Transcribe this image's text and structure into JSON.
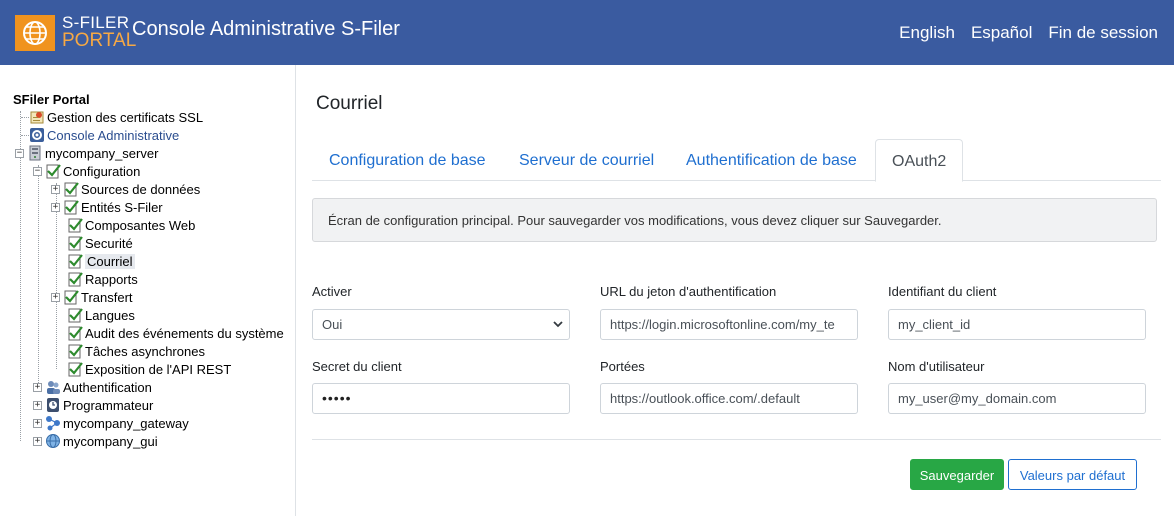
{
  "header": {
    "logo_line1": "S-FILER",
    "logo_line2": "PORTAL",
    "title": "Console Administrative S-Filer",
    "links": [
      "English",
      "Español",
      "Fin de session"
    ],
    "bg_color": "#3a5ba0",
    "logo_color": "#f0931e"
  },
  "tree": {
    "root": "SFiler Portal",
    "items": [
      {
        "label": "Gestion des certificats SSL",
        "icon": "certificate-icon"
      },
      {
        "label": "Console Administrative",
        "icon": "gear-icon"
      },
      {
        "label": "mycompany_server",
        "icon": "server-icon"
      },
      {
        "label": "Configuration",
        "icon": "check-doc-icon"
      },
      {
        "label": "Sources de données",
        "icon": "check-doc-icon"
      },
      {
        "label": "Entités S-Filer",
        "icon": "check-doc-icon"
      },
      {
        "label": "Composantes Web",
        "icon": "check-doc-icon"
      },
      {
        "label": "Securité",
        "icon": "check-doc-icon"
      },
      {
        "label": "Courriel",
        "icon": "check-doc-icon"
      },
      {
        "label": "Rapports",
        "icon": "check-doc-icon"
      },
      {
        "label": "Transfert",
        "icon": "check-doc-icon"
      },
      {
        "label": "Langues",
        "icon": "check-doc-icon"
      },
      {
        "label": "Audit des événements du système",
        "icon": "check-doc-icon"
      },
      {
        "label": "Tâches asynchrones",
        "icon": "check-doc-icon"
      },
      {
        "label": "Exposition de l'API REST",
        "icon": "check-doc-icon"
      },
      {
        "label": "Authentification",
        "icon": "users-icon"
      },
      {
        "label": "Programmateur",
        "icon": "clock-icon"
      },
      {
        "label": "mycompany_gateway",
        "icon": "network-icon"
      },
      {
        "label": "mycompany_gui",
        "icon": "globe-icon"
      }
    ]
  },
  "main": {
    "title": "Courriel",
    "tabs": [
      "Configuration de base",
      "Serveur de courriel",
      "Authentification de base",
      "OAuth2"
    ],
    "active_tab": "OAuth2",
    "info": "Écran de configuration principal. Pour sauvegarder vos modifications, vous devez cliquer sur Sauvegarder.",
    "fields": {
      "activer": {
        "label": "Activer",
        "value": "Oui"
      },
      "url_jeton": {
        "label": "URL du jeton d'authentification",
        "value": "https://login.microsoftonline.com/my_te"
      },
      "client_id": {
        "label": "Identifiant du client",
        "value": "my_client_id"
      },
      "secret": {
        "label": "Secret du client",
        "value": "•••••"
      },
      "portees": {
        "label": "Portées",
        "value": "https://outlook.office.com/.default"
      },
      "username": {
        "label": "Nom d'utilisateur",
        "value": "my_user@my_domain.com"
      }
    },
    "buttons": {
      "save": "Sauvegarder",
      "defaults": "Valeurs par défaut"
    }
  }
}
